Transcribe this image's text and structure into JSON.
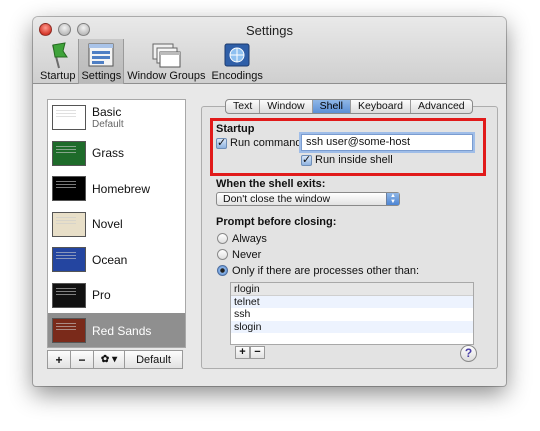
{
  "window": {
    "title": "Settings"
  },
  "toolbar": {
    "items": [
      {
        "label": "Startup",
        "icon": "flag-icon",
        "active": false
      },
      {
        "label": "Settings",
        "icon": "settings-window-icon",
        "active": true
      },
      {
        "label": "Window Groups",
        "icon": "window-groups-icon",
        "active": false
      },
      {
        "label": "Encodings",
        "icon": "encodings-globe-icon",
        "active": false
      }
    ]
  },
  "profiles": [
    {
      "name": "Basic",
      "subtitle": "Default",
      "thumb_bg": "#ffffff",
      "thumb_fg": "#222222"
    },
    {
      "name": "Grass",
      "subtitle": "",
      "thumb_bg": "#1e6b2a",
      "thumb_fg": "#d9f5c0"
    },
    {
      "name": "Homebrew",
      "subtitle": "",
      "thumb_bg": "#000000",
      "thumb_fg": "#22d022"
    },
    {
      "name": "Novel",
      "subtitle": "",
      "thumb_bg": "#e8dfc8",
      "thumb_fg": "#4a3b20"
    },
    {
      "name": "Ocean",
      "subtitle": "",
      "thumb_bg": "#2445a0",
      "thumb_fg": "#ffffff"
    },
    {
      "name": "Pro",
      "subtitle": "",
      "thumb_bg": "#111111",
      "thumb_fg": "#f0f0f0"
    },
    {
      "name": "Red Sands",
      "subtitle": "",
      "thumb_bg": "#7a2a1a",
      "thumb_fg": "#e8c9a0",
      "selected": true
    }
  ],
  "list_buttons": {
    "add": "+",
    "remove": "−",
    "gear": "✿ ▾",
    "default": "Default"
  },
  "tabs": [
    {
      "label": "Text",
      "active": false
    },
    {
      "label": "Window",
      "active": false
    },
    {
      "label": "Shell",
      "active": true
    },
    {
      "label": "Keyboard",
      "active": false
    },
    {
      "label": "Advanced",
      "active": false
    }
  ],
  "startup": {
    "heading": "Startup",
    "run_command_label": "Run command:",
    "run_command_checked": true,
    "run_command_value": "ssh user@some-host",
    "run_inside_shell_label": "Run inside shell",
    "run_inside_shell_checked": true
  },
  "shell_exit": {
    "heading": "When the shell exits:",
    "selected": "Don't close the window"
  },
  "prompt": {
    "heading": "Prompt before closing:",
    "options": [
      "Always",
      "Never",
      "Only if there are processes other than:"
    ],
    "selected_index": 2,
    "processes": [
      "rlogin",
      "telnet",
      "ssh",
      "slogin"
    ]
  },
  "process_buttons": {
    "add": "+",
    "remove": "−"
  },
  "help": "?",
  "colors": {
    "highlight_box": "#e11a1a",
    "selected_row": "#8f8f8f",
    "accent_blue": "#5b8fd6"
  }
}
